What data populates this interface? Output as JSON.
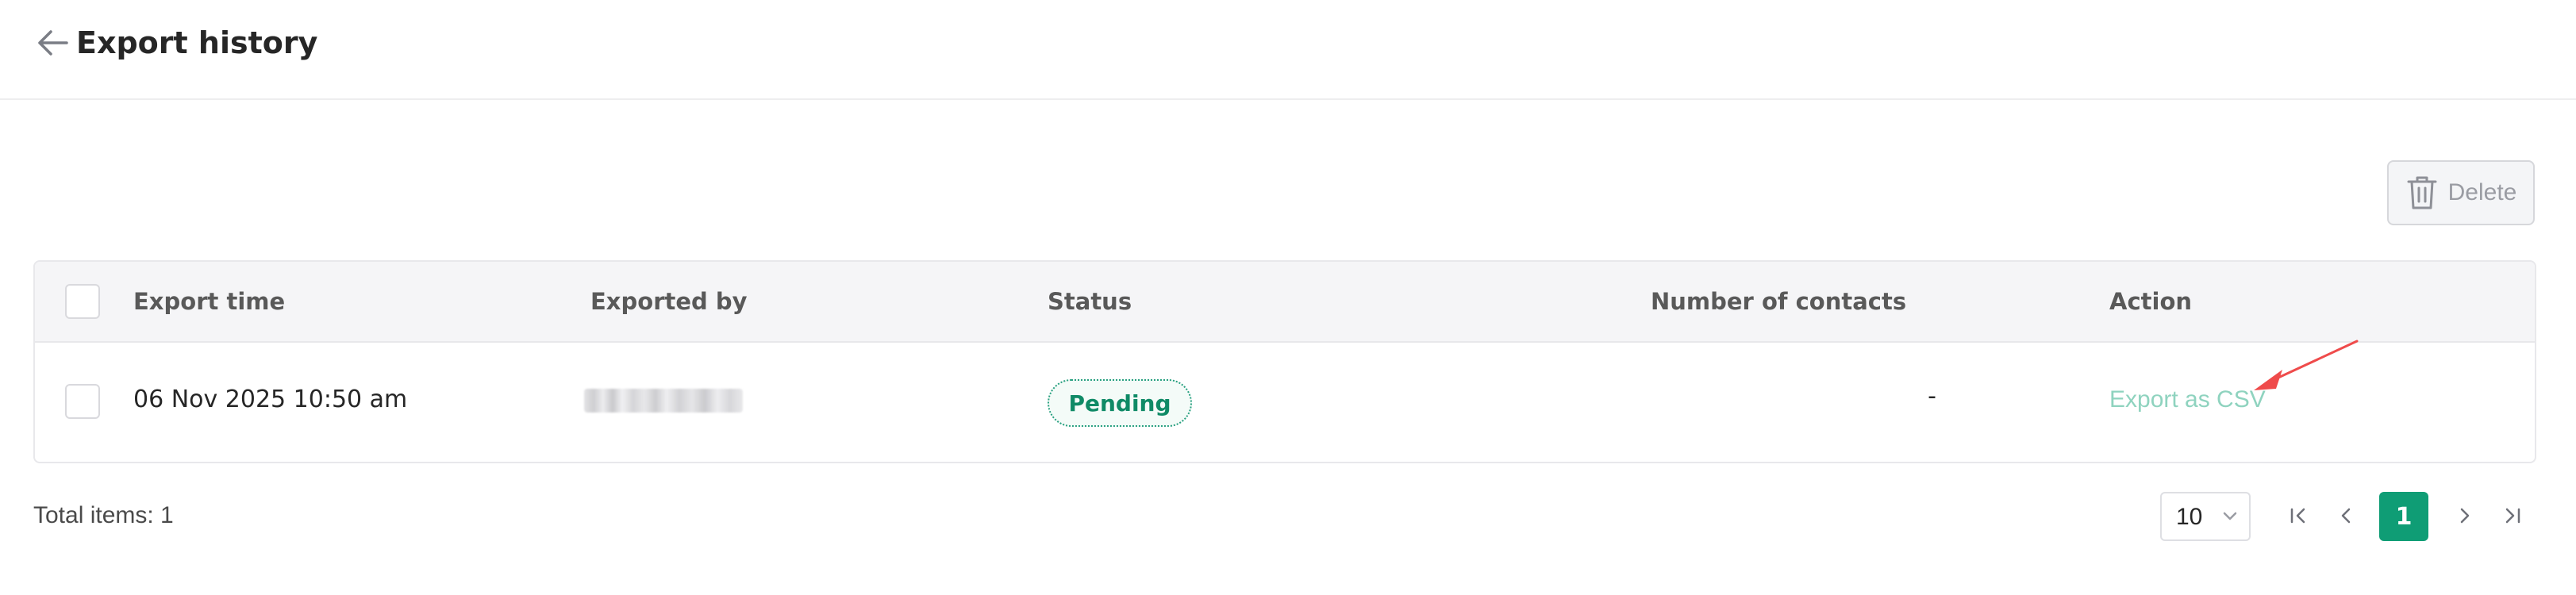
{
  "header": {
    "title": "Export history",
    "back_icon": "arrow-left-icon"
  },
  "toolbar": {
    "delete_label": "Delete",
    "delete_icon": "trash-icon",
    "delete_disabled": true
  },
  "table": {
    "columns": [
      "Export time",
      "Exported by",
      "Status",
      "Number of contacts",
      "Action"
    ],
    "rows": [
      {
        "export_time": "06 Nov 2025 10:50 am",
        "exported_by": "",
        "exported_by_obscured": true,
        "status": "Pending",
        "number_of_contacts": "-",
        "action": "Export as CSV"
      }
    ]
  },
  "footer": {
    "total_items": "Total items: 1",
    "page_size": "10",
    "current_page": "1"
  },
  "colors": {
    "accent": "#0f9d75",
    "status_text": "#0f8a66",
    "link": "#8fd3bf",
    "annotation_arrow": "#ef4b4b"
  }
}
